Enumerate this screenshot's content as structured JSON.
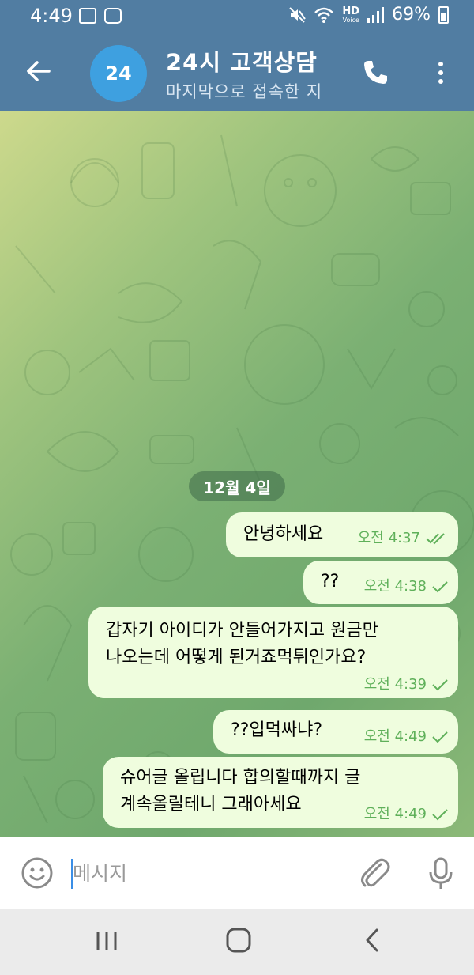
{
  "status_bar": {
    "time": "4:49",
    "network": "HD",
    "network_sub": "Voice",
    "battery": "69%",
    "icons": [
      "gallery-icon",
      "screen-record-icon",
      "mute-icon",
      "wifi-icon",
      "signal-icon",
      "battery-icon"
    ]
  },
  "header": {
    "avatar_text": "24",
    "title": "24시 고객상담",
    "subtitle": "마지막으로 접속한 지",
    "accent_color": "#517da2",
    "avatar_color": "#3ea0e0"
  },
  "chat": {
    "date_label": "12월 4일",
    "messages": [
      {
        "lines": [
          "안녕하세요"
        ],
        "time": "오전 4:37",
        "status": "read"
      },
      {
        "lines": [
          "??"
        ],
        "time": "오전 4:38",
        "status": "sent"
      },
      {
        "lines": [
          "갑자기 아이디가 안들어가지고 원금만",
          "나오는데 어떻게 된거죠먹튀인가요?"
        ],
        "time": "오전 4:39",
        "status": "sent"
      },
      {
        "lines": [
          "??입먹싸냐?"
        ],
        "time": "오전 4:49",
        "status": "sent"
      },
      {
        "lines": [
          "슈어글 올립니다 합의할때까지 글",
          "계속올릴테니 그래아세요"
        ],
        "time": "오전 4:49",
        "status": "sent"
      }
    ],
    "bubble_color": "#effdde",
    "check_color": "#5fb05a"
  },
  "input_bar": {
    "placeholder": "메시지"
  }
}
